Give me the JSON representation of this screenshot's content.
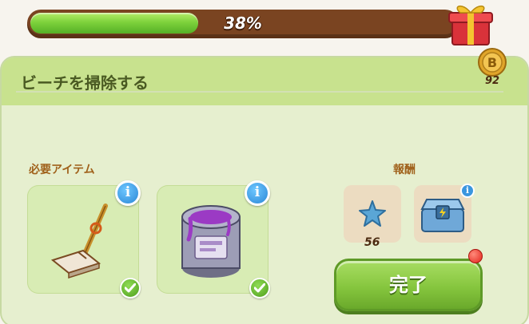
{
  "progress": {
    "label": "38%",
    "value": 0.38
  },
  "quest": {
    "title": "ビーチを掃除する"
  },
  "currency": {
    "count": "92",
    "icon": "coin-icon"
  },
  "required": {
    "label": "必要アイテム",
    "items": [
      {
        "name": "mop",
        "icon": "mop-icon",
        "done": true
      },
      {
        "name": "paint-can",
        "icon": "paint-can-icon",
        "done": true
      }
    ]
  },
  "rewards": {
    "label": "報酬",
    "items": [
      {
        "icon": "blue-star-icon",
        "count": "56"
      },
      {
        "icon": "energy-chest-icon"
      }
    ]
  },
  "actions": {
    "complete_label": "完了"
  },
  "colors": {
    "accent": "#86c63e",
    "progress_track": "#7a4421",
    "notification": "#e2241c"
  }
}
